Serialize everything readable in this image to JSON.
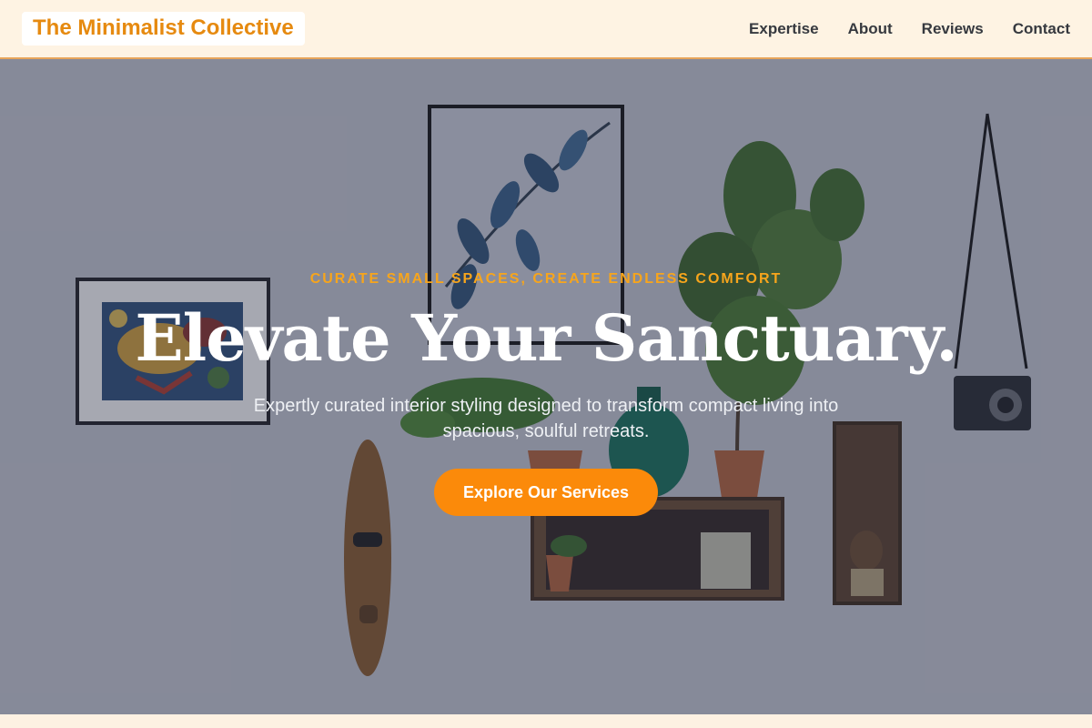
{
  "brand": "The Minimalist Collective",
  "nav": {
    "links": [
      "Expertise",
      "About",
      "Reviews",
      "Contact"
    ]
  },
  "hero": {
    "eyebrow": "CURATE SMALL SPACES, CREATE ENDLESS COMFORT",
    "title": "Elevate Your Sanctuary.",
    "subtitle": "Expertly curated interior styling designed to transform compact living into spacious, soulful retreats.",
    "cta_label": "Explore Our Services"
  },
  "colors": {
    "accent": "#fb8a0a",
    "brand_text": "#e68a10",
    "eyebrow": "#f7a51c",
    "nav_bg": "#fef3e3"
  }
}
